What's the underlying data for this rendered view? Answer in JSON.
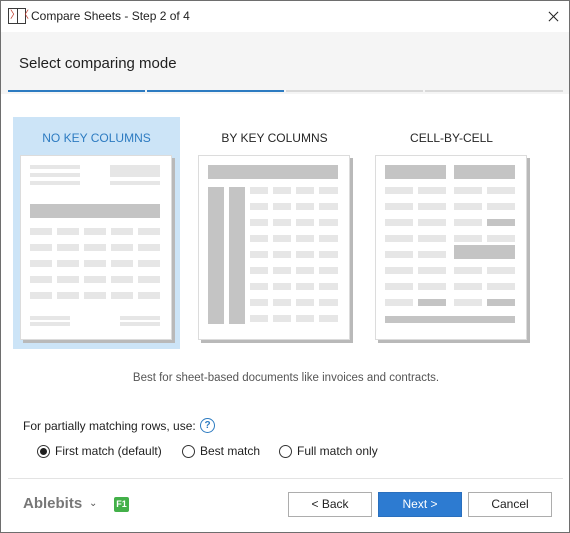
{
  "window": {
    "title": "Compare Sheets - Step 2 of 4",
    "icon_left": "〉",
    "icon_right": "〈"
  },
  "header": {
    "title": "Select comparing mode",
    "steps": [
      {
        "state": "done",
        "color": "#2d7bc1"
      },
      {
        "state": "current",
        "color": "#2d7bc1"
      },
      {
        "state": "pending",
        "color": "#d9d9d9"
      },
      {
        "state": "pending",
        "color": "#d9d9d9"
      }
    ]
  },
  "modes": [
    {
      "label": "NO KEY COLUMNS",
      "selected": true
    },
    {
      "label": "BY KEY COLUMNS",
      "selected": false
    },
    {
      "label": "CELL-BY-CELL",
      "selected": false
    }
  ],
  "description": "Best for sheet-based documents like invoices and contracts.",
  "partial_match": {
    "label": "For partially matching rows, use:",
    "help_icon": "question-circle-icon",
    "help_glyph": "?",
    "options": [
      {
        "label": "First match (default)",
        "checked": true
      },
      {
        "label": "Best match",
        "checked": false
      },
      {
        "label": "Full match only",
        "checked": false
      }
    ]
  },
  "footer": {
    "brand": "Ablebits",
    "brand_chevron": "⌄",
    "f1_label": "F1",
    "back_label": "< Back",
    "next_label": "Next >",
    "cancel_label": "Cancel"
  },
  "colors": {
    "accent": "#2d7bc1",
    "selected_bg": "#cce4f7",
    "primary_button": "#2d7bd1",
    "f1_badge": "#43b049"
  }
}
